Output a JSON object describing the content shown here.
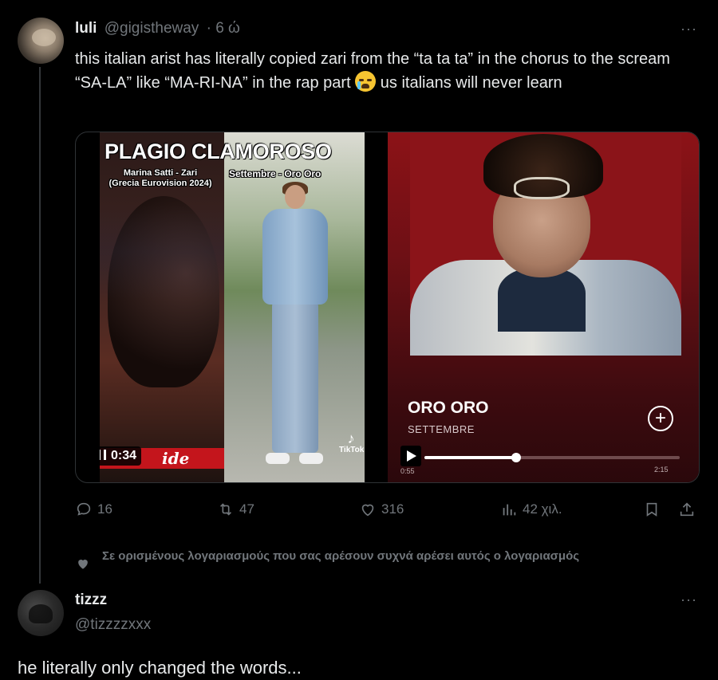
{
  "tweet1": {
    "name": "luli",
    "handle": "@gigistheway",
    "time": "· 6 ώ",
    "text_before_emoji": "this italian arist has literally copied zari from the “ta ta ta” in the chorus to the scream “SA-LA” like “MA-RI-NA” in the rap part ",
    "emoji": "loudly-crying-face",
    "text_after_emoji": " us italians will never learn",
    "more": "···"
  },
  "video": {
    "title": "PLAGIO CLAMOROSO",
    "left_caption_line1": "Marina Satti - Zari",
    "left_caption_line2": "(Grecia Eurovision 2024)",
    "right_caption": "Settembre - Oro Oro",
    "banner_text": "ide",
    "watermark": "TikTok",
    "duration": "0:34"
  },
  "spotify": {
    "song_title": "ORO ORO",
    "artist": "SETTEMBRE",
    "progress": 0.36,
    "elapsed": "0:55",
    "total": "2:15"
  },
  "actions": {
    "replies": "16",
    "reposts": "47",
    "likes": "316",
    "views": "42 χιλ."
  },
  "liked_by_notice": "Σε ορισμένους λογαριασμούς που σας αρέσουν συχνά αρέσει αυτός ο λογαριασμός",
  "tweet2": {
    "name": "tizzz",
    "handle": "@tizzzzxxx",
    "text": "he literally only changed the words...",
    "more": "···"
  },
  "colors": {
    "background": "#000000",
    "text": "#e7e9ea",
    "muted": "#71767b",
    "spotify_red": "#8c1217"
  }
}
